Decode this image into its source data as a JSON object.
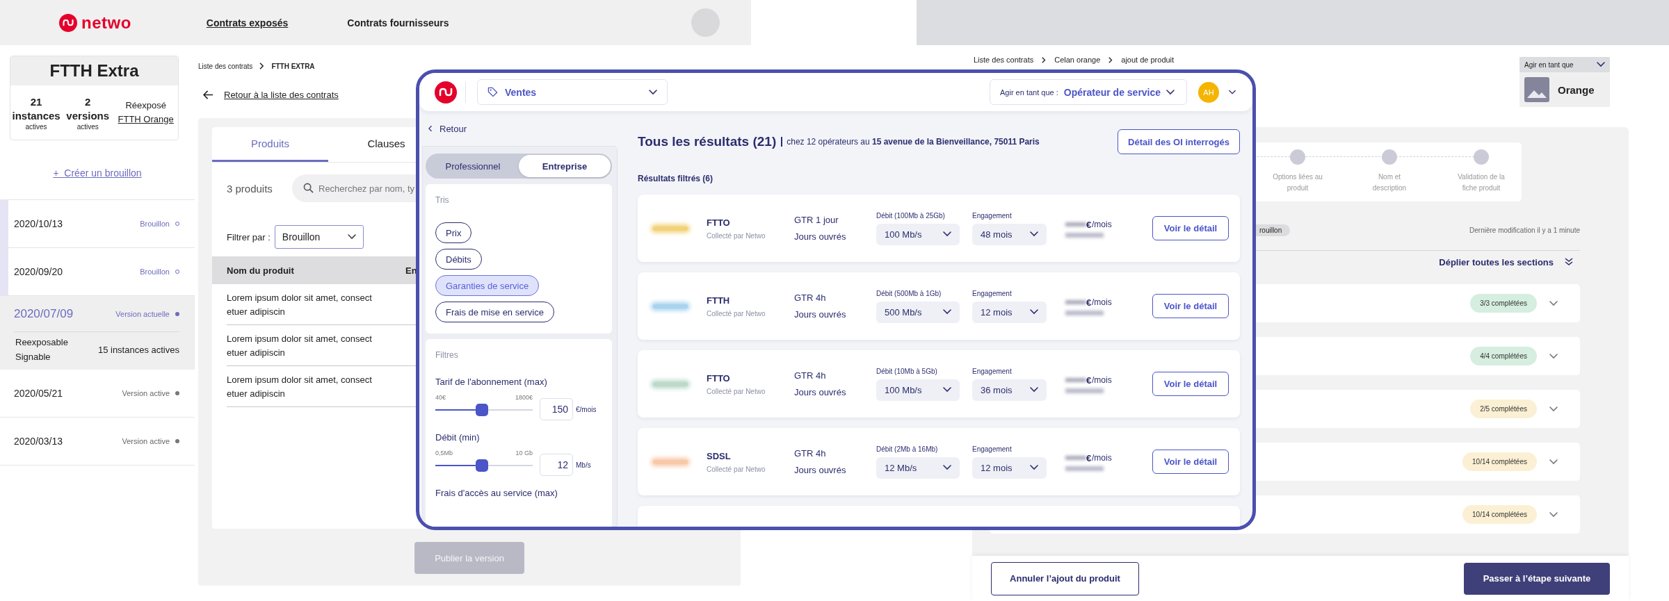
{
  "left_app": {
    "logo": "netwo",
    "nav": [
      {
        "label": "Contrats exposés",
        "selected": true
      },
      {
        "label": "Contrats fournisseurs",
        "selected": false
      }
    ],
    "contract_card": {
      "title": "FTTH Extra",
      "stats": [
        {
          "value": "21",
          "label": "instances",
          "sub": "actives"
        },
        {
          "value": "2",
          "label": "versions",
          "sub": "actives"
        }
      ],
      "reexposed_label": "Réexposé",
      "reexposed_link": "FTTH Orange"
    },
    "create_draft": {
      "icon": "+",
      "label": "Créer un brouillon"
    },
    "versions": [
      {
        "date": "2020/10/13",
        "status": "Brouillon",
        "kind": "draft",
        "selected": false,
        "highlighted": true
      },
      {
        "date": "2020/09/20",
        "status": "Brouillon",
        "kind": "draft",
        "selected": false,
        "highlighted": true
      },
      {
        "date": "2020/07/09",
        "status": "Version actuelle",
        "kind": "current",
        "selected": true,
        "highlighted": false,
        "flags": [
          "Reexposable",
          "Signable"
        ],
        "instances": "15 instances actives"
      },
      {
        "date": "2020/05/21",
        "status": "Version active",
        "kind": "active",
        "selected": false,
        "highlighted": false
      },
      {
        "date": "2020/03/13",
        "status": "Version active",
        "kind": "active",
        "selected": false,
        "highlighted": false
      }
    ],
    "breadcrumb": [
      "Liste des contrats",
      "FTTH EXTRA"
    ],
    "back_link": "Retour à la liste des contrats",
    "tabs": [
      {
        "label": "Produits",
        "selected": true
      },
      {
        "label": "Clauses",
        "selected": false
      }
    ],
    "product_count": "3 produits",
    "search": {
      "placeholder": "Recherchez par nom, ty"
    },
    "filter": {
      "label": "Filtrer par :",
      "value": "Brouillon"
    },
    "table": {
      "columns": [
        "Nom du produit",
        "En"
      ],
      "rows": [
        {
          "name": "Lorem ipsum dolor sit amet, consect etuer adipiscin"
        },
        {
          "name": "Lorem ipsum dolor sit amet, consect etuer adipiscin"
        },
        {
          "name": "Lorem ipsum dolor sit amet, consect etuer adipiscin"
        }
      ]
    },
    "publish_button": {
      "label": "Publier la version",
      "disabled": true
    }
  },
  "right_app": {
    "breadcrumb": [
      "Liste des contrats",
      "Celan orange",
      "ajout de produit"
    ],
    "role_box": {
      "label": "Agir en tant que",
      "value": "Orange"
    },
    "steps": [
      {
        "label": "Options liées au produit"
      },
      {
        "label": "Nom et description"
      },
      {
        "label": "Validation de la fiche produit"
      }
    ],
    "status_chip": "rouillon",
    "last_modified": "Dernière modification il y a 1 minute",
    "expand_all": "Déplier toutes les sections",
    "sections": [
      {
        "progress": "3/3 complétées",
        "complete": true
      },
      {
        "progress": "4/4 complétées",
        "complete": true
      },
      {
        "progress": "2/5 complétées",
        "complete": false
      },
      {
        "progress": "10/14 complétées",
        "complete": false
      },
      {
        "progress": "10/14 complétées",
        "complete": false
      }
    ],
    "cancel_button": "Annuler l’ajout du produit",
    "next_button": "Passer à l’étape suivante"
  },
  "modal": {
    "context_select": {
      "value": "Ventes"
    },
    "role_select": {
      "label": "Agir en tant que :",
      "value": "Opérateur de service"
    },
    "avatar": "AH",
    "back": "Retour",
    "segments": [
      {
        "label": "Professionnel",
        "selected": false
      },
      {
        "label": "Entreprise",
        "selected": true
      }
    ],
    "sorts": {
      "title": "Tris",
      "options": [
        {
          "label": "Prix",
          "selected": false
        },
        {
          "label": "Débits",
          "selected": false
        },
        {
          "label": "Garanties de service",
          "selected": true
        },
        {
          "label": "Frais de mise en service",
          "selected": false
        }
      ]
    },
    "filters": {
      "title": "Filtres",
      "sliders": [
        {
          "label": "Tarif de l'abonnement (max)",
          "min": "40€",
          "max": "1800€",
          "level": 0.48,
          "value": "150",
          "unit": "€/mois"
        },
        {
          "label": "Débit (min)",
          "min": "0,5Mb",
          "max": "10 Gb",
          "level": 0.48,
          "value": "12",
          "unit": "Mb/s"
        },
        {
          "label": "Frais d'accès au service (max)"
        }
      ]
    },
    "results_title": "Tous les résultats (21)",
    "results_subtitle": "chez 12 opérateurs au **15 avenue de la Bienveillance, 75011 Paris**",
    "oi_button": "Détail des OI interrogés",
    "filtered_title": "Résultats filtrés (6)",
    "offers": [
      {
        "name": "FTTO",
        "collector": "Collecté par Netwo",
        "gtr": "GTR 1 jour",
        "days": "Jours ouvrés",
        "speed_label": "Débit (100Mb à 25Gb)",
        "speed": "100 Mb/s",
        "commitment_label": "Engagement",
        "commitment": "48 mois",
        "currency": "€",
        "period": "/mois",
        "button": "Voir le détail",
        "color": "#f2d27a"
      },
      {
        "name": "FTTH",
        "collector": "Collecté par Netwo",
        "gtr": "GTR 4h",
        "days": "Jours ouvrés",
        "speed_label": "Débit (500Mb à 1Gb)",
        "speed": "500 Mb/s",
        "commitment_label": "Engagement",
        "commitment": "12 mois",
        "currency": "€",
        "period": "/mois",
        "button": "Voir le détail",
        "color": "#a9d3ee"
      },
      {
        "name": "FTTO",
        "collector": "Collecté par Netwo",
        "gtr": "GTR 4h",
        "days": "Jours ouvrés",
        "speed_label": "Débit (10Mb à 5Gb)",
        "speed": "100 Mb/s",
        "commitment_label": "Engagement",
        "commitment": "36 mois",
        "currency": "€",
        "period": "/mois",
        "button": "Voir le détail",
        "color": "#bcd9c9"
      },
      {
        "name": "SDSL",
        "collector": "Collecté par Netwo",
        "gtr": "GTR 4h",
        "days": "Jours ouvrés",
        "speed_label": "Débit (2Mb à 16Mb)",
        "speed": "12 Mb/s",
        "commitment_label": "Engagement",
        "commitment": "12 mois",
        "currency": "€",
        "period": "/mois",
        "button": "Voir le détail",
        "color": "#f8c9a8"
      }
    ]
  }
}
